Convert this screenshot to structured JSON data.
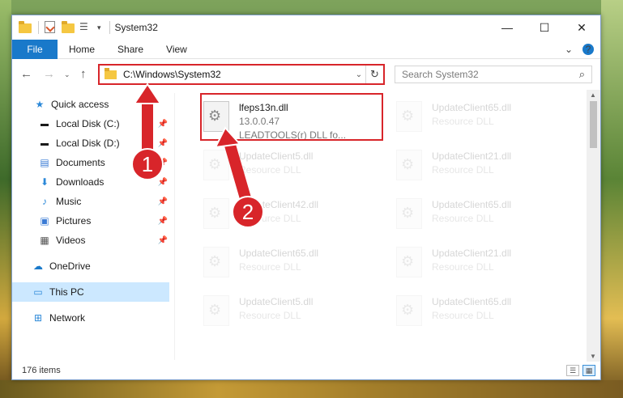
{
  "window": {
    "title": "System32"
  },
  "ribbon": {
    "tabs": [
      "File",
      "Home",
      "Share",
      "View"
    ]
  },
  "address": {
    "path": "C:\\Windows\\System32",
    "search_placeholder": "Search System32"
  },
  "nav": {
    "items": [
      {
        "label": "Quick access",
        "icon": "star-icon",
        "pinned": false
      },
      {
        "label": "Local Disk (C:)",
        "icon": "drive-icon",
        "pinned": true
      },
      {
        "label": "Local Disk (D:)",
        "icon": "drive-icon",
        "pinned": true
      },
      {
        "label": "Documents",
        "icon": "documents-icon",
        "pinned": true
      },
      {
        "label": "Downloads",
        "icon": "download-icon",
        "pinned": true
      },
      {
        "label": "Music",
        "icon": "music-icon",
        "pinned": true
      },
      {
        "label": "Pictures",
        "icon": "pictures-icon",
        "pinned": true
      },
      {
        "label": "Videos",
        "icon": "videos-icon",
        "pinned": true
      },
      {
        "label": "OneDrive",
        "icon": "cloud-icon",
        "pinned": false
      },
      {
        "label": "This PC",
        "icon": "computer-icon",
        "pinned": false,
        "selected": true
      },
      {
        "label": "Network",
        "icon": "network-icon",
        "pinned": false
      }
    ]
  },
  "files": [
    {
      "name": "lfeps13n.dll",
      "line2": "13.0.0.47",
      "line3": "LEADTOOLS(r) DLL fo...",
      "highlighted": true
    },
    {
      "name": "UpdateClient65.dll",
      "line2": "Resource DLL"
    },
    {
      "name": "UpdateClient5.dll",
      "line2": "Resource DLL"
    },
    {
      "name": "UpdateClient21.dll",
      "line2": "Resource DLL"
    },
    {
      "name": "UpdateClient42.dll",
      "line2": "Resource DLL"
    },
    {
      "name": "UpdateClient65.dll",
      "line2": "Resource DLL"
    },
    {
      "name": "UpdateClient65.dll",
      "line2": "Resource DLL"
    },
    {
      "name": "UpdateClient21.dll",
      "line2": "Resource DLL"
    },
    {
      "name": "UpdateClient5.dll",
      "line2": "Resource DLL"
    },
    {
      "name": "UpdateClient65.dll",
      "line2": "Resource DLL"
    }
  ],
  "status": {
    "count": "176 items"
  },
  "annotations": {
    "badge1": "1",
    "badge2": "2"
  },
  "colors": {
    "accent": "#1979ca",
    "highlight": "#d8252a",
    "selected_bg": "#cce8ff"
  }
}
